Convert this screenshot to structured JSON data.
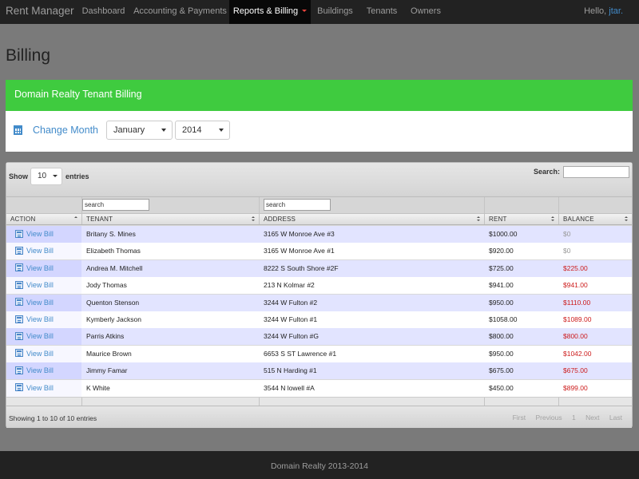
{
  "nav": {
    "brand": "Rent Manager",
    "items": [
      {
        "label": "Dashboard"
      },
      {
        "label": "Accounting & Payments"
      },
      {
        "label": "Reports & Billing"
      },
      {
        "label": "Buildings"
      },
      {
        "label": "Tenants"
      },
      {
        "label": "Owners"
      }
    ],
    "hello": "Hello, ",
    "username": "jtar."
  },
  "page": {
    "title": "Billing"
  },
  "panel": {
    "heading": "Domain Realty Tenant Billing",
    "heading_color": "#3fcb3f",
    "change_month_label": "Change Month",
    "month_value": "January",
    "year_value": "2014"
  },
  "table": {
    "show_label": "Show",
    "page_length": "10",
    "entries_label": "entries",
    "search_label": "Search:",
    "search_value": "",
    "filter_placeholder": "search",
    "columns": [
      "ACTION",
      "TENANT",
      "ADDRESS",
      "RENT",
      "BALANCE"
    ],
    "rows": [
      {
        "action": "View Bill",
        "tenant": "Britany S. Mines",
        "address": "3165 W Monroe Ave #3",
        "rent": "$1000.00",
        "balance": "$0",
        "status": "zero"
      },
      {
        "action": "View Bill",
        "tenant": "Elizabeth Thomas",
        "address": "3165 W Monroe Ave #1",
        "rent": "$920.00",
        "balance": "$0",
        "status": "zero"
      },
      {
        "action": "View Bill",
        "tenant": "Andrea M. Mitchell",
        "address": "8222 S South Shore #2F",
        "rent": "$725.00",
        "balance": "$225.00",
        "status": "owed"
      },
      {
        "action": "View Bill",
        "tenant": "Jody Thomas",
        "address": "213 N Kolmar #2",
        "rent": "$941.00",
        "balance": "$941.00",
        "status": "owed"
      },
      {
        "action": "View Bill",
        "tenant": "Quenton Stenson",
        "address": "3244 W Fulton #2",
        "rent": "$950.00",
        "balance": "$1110.00",
        "status": "owed"
      },
      {
        "action": "View Bill",
        "tenant": "Kymberly Jackson",
        "address": "3244 W Fulton #1",
        "rent": "$1058.00",
        "balance": "$1089.00",
        "status": "owed"
      },
      {
        "action": "View Bill",
        "tenant": "Parris Atkins",
        "address": "3244 W Fulton #G",
        "rent": "$800.00",
        "balance": "$800.00",
        "status": "owed"
      },
      {
        "action": "View Bill",
        "tenant": "Maurice Brown",
        "address": "6653 S ST Lawrence #1",
        "rent": "$950.00",
        "balance": "$1042.00",
        "status": "owed"
      },
      {
        "action": "View Bill",
        "tenant": "Jimmy Famar",
        "address": "515 N Harding #1",
        "rent": "$675.00",
        "balance": "$675.00",
        "status": "owed"
      },
      {
        "action": "View Bill",
        "tenant": "K White",
        "address": "3544 N lowell #A",
        "rent": "$450.00",
        "balance": "$899.00",
        "status": "owed"
      }
    ],
    "info": "Showing 1 to 10 of 10 entries",
    "pager": {
      "first": "First",
      "previous": "Previous",
      "page": "1",
      "next": "Next",
      "last": "Last"
    },
    "colors": {
      "balance_owed": "#cc1a1a",
      "balance_zero": "#999999",
      "link": "#428bca"
    }
  },
  "footer": {
    "text": "Domain Realty 2013-2014"
  }
}
